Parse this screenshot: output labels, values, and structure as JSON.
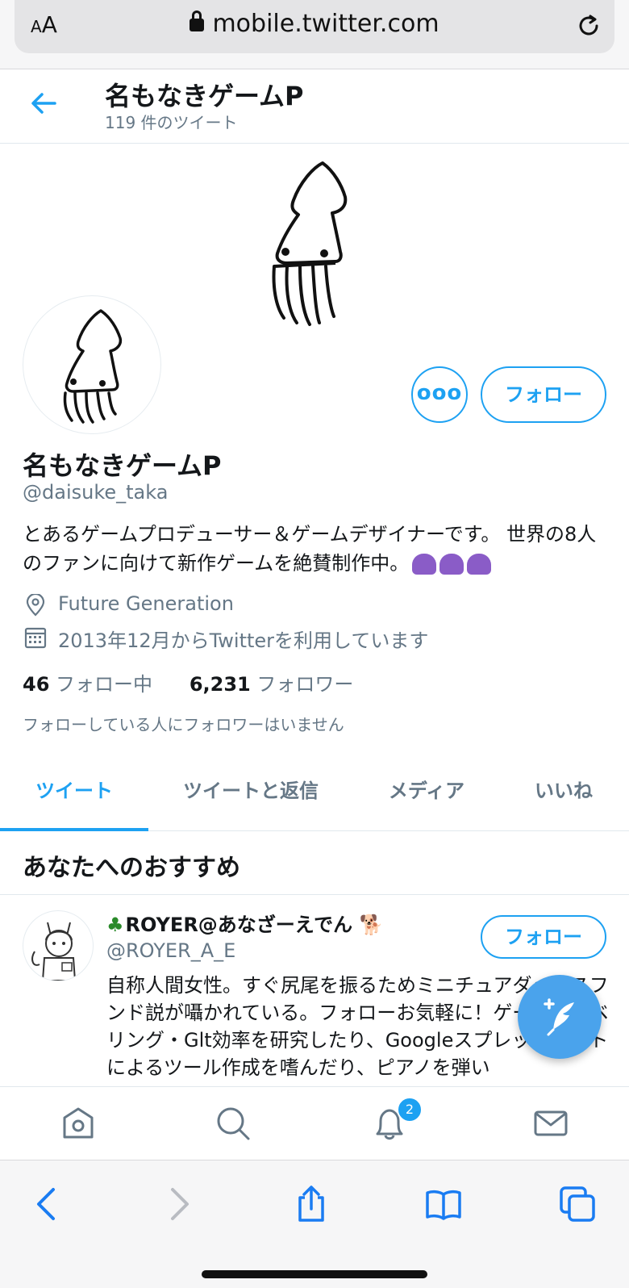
{
  "browser": {
    "aa_label_small": "A",
    "aa_label_large": "A",
    "url": "mobile.twitter.com"
  },
  "header": {
    "name": "名もなきゲームP",
    "tweet_count": "119 件のツイート"
  },
  "profile": {
    "name": "名もなきゲームP",
    "handle": "@daisuke_taka",
    "bio": "とあるゲームプロデューサー＆ゲームデザイナーです。 世界の8人のファンに向けて新作ゲームを絶賛制作中。",
    "more_label": "ooo",
    "follow_label": "フォロー",
    "location": "Future Generation",
    "joined": "2013年12月からTwitterを利用しています",
    "following_count": "46",
    "following_label": "フォロー中",
    "followers_count": "6,231",
    "followers_label": "フォロワー",
    "followers_note": "フォローしている人にフォロワーはいません"
  },
  "tabs": [
    {
      "label": "ツイート",
      "active": true
    },
    {
      "label": "ツイートと返信",
      "active": false
    },
    {
      "label": "メディア",
      "active": false
    },
    {
      "label": "いいね",
      "active": false
    }
  ],
  "recommend": {
    "title": "あなたへのおすすめ",
    "user": {
      "name": "ROYER@あなざーえでん",
      "handle": "@ROYER_A_E",
      "follow_label": "フォロー",
      "bio": "自称人間女性。すぐ尻尾を振るためミニチュアダックスフンド説が囁かれている。フォローお気軽に！ゲームのレベリング・Glt効率を研究したり、Googleスプレッドシートによるツール作成を嗜んだり、ピアノを弾い"
    }
  },
  "nav": {
    "notifications_badge": "2",
    "icons": [
      "home-icon",
      "search-icon",
      "bell-icon",
      "mail-icon"
    ]
  },
  "colors": {
    "accent": "#1da1f2",
    "secondary_text": "#657786"
  }
}
